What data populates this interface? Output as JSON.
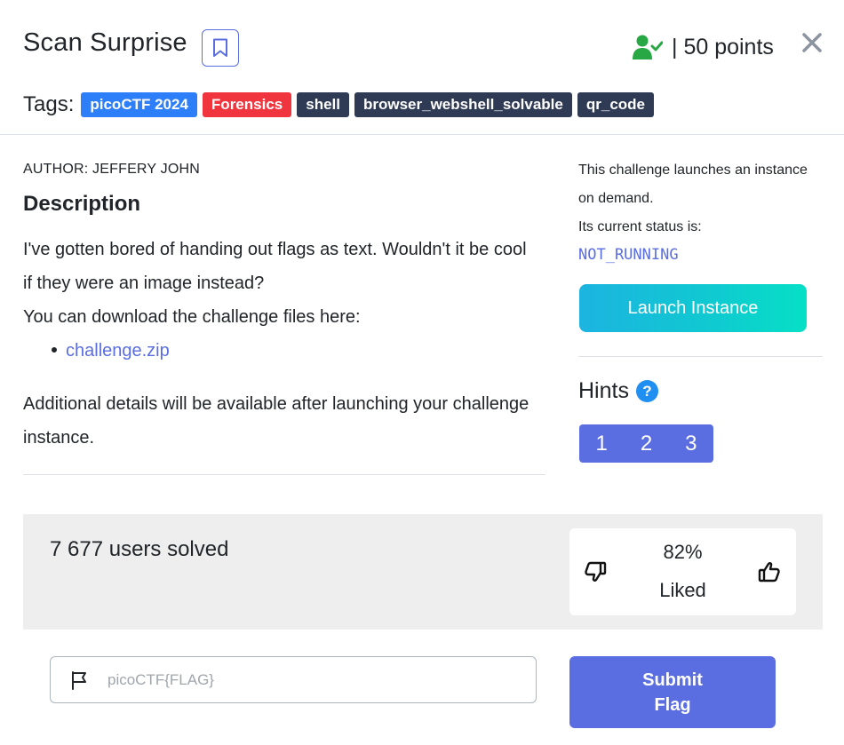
{
  "challenge": {
    "title": "Scan Surprise",
    "points": "| 50 points"
  },
  "tags": {
    "label": "Tags:",
    "items": [
      {
        "text": "picoCTF 2024",
        "color": "#2d7ff9"
      },
      {
        "text": "Forensics",
        "color": "#f0353f"
      },
      {
        "text": "shell",
        "color": "#2f3a55"
      },
      {
        "text": "browser_webshell_solvable",
        "color": "#2f3a55"
      },
      {
        "text": "qr_code",
        "color": "#2f3a55"
      }
    ]
  },
  "description": {
    "author": "AUTHOR: JEFFERY JOHN",
    "heading": "Description",
    "line1": "I've gotten bored of handing out flags as text. Wouldn't it be cool if they were an image instead?",
    "line2": "You can download the challenge files here:",
    "file_link": "challenge.zip",
    "additional": "Additional details will be available after launching your challenge instance."
  },
  "instance": {
    "info_line1": "This challenge launches an instance on demand.",
    "info_line2": "Its current status is:",
    "status": "NOT_RUNNING",
    "launch_label": "Launch Instance"
  },
  "hints": {
    "heading": "Hints",
    "help": "?",
    "buttons": [
      "1",
      "2",
      "3"
    ]
  },
  "stats": {
    "solved": "7 677 users solved",
    "liked_percent": "82%",
    "liked_label": "Liked"
  },
  "flag": {
    "placeholder": "picoCTF{FLAG}",
    "value": "",
    "submit_label_line1": "Submit",
    "submit_label_line2": "Flag"
  },
  "colors": {
    "accent": "#5b6ee1",
    "success": "#28a745",
    "launch_gradient_start": "#1cb4e0",
    "launch_gradient_end": "#06e0c6"
  },
  "icons": {
    "bookmark": "bookmark-icon",
    "solved": "user-check-icon",
    "close": "close-icon",
    "help": "help-icon",
    "thumb_down": "thumb-down-icon",
    "thumb_up": "thumb-up-icon",
    "flag": "flag-icon"
  }
}
